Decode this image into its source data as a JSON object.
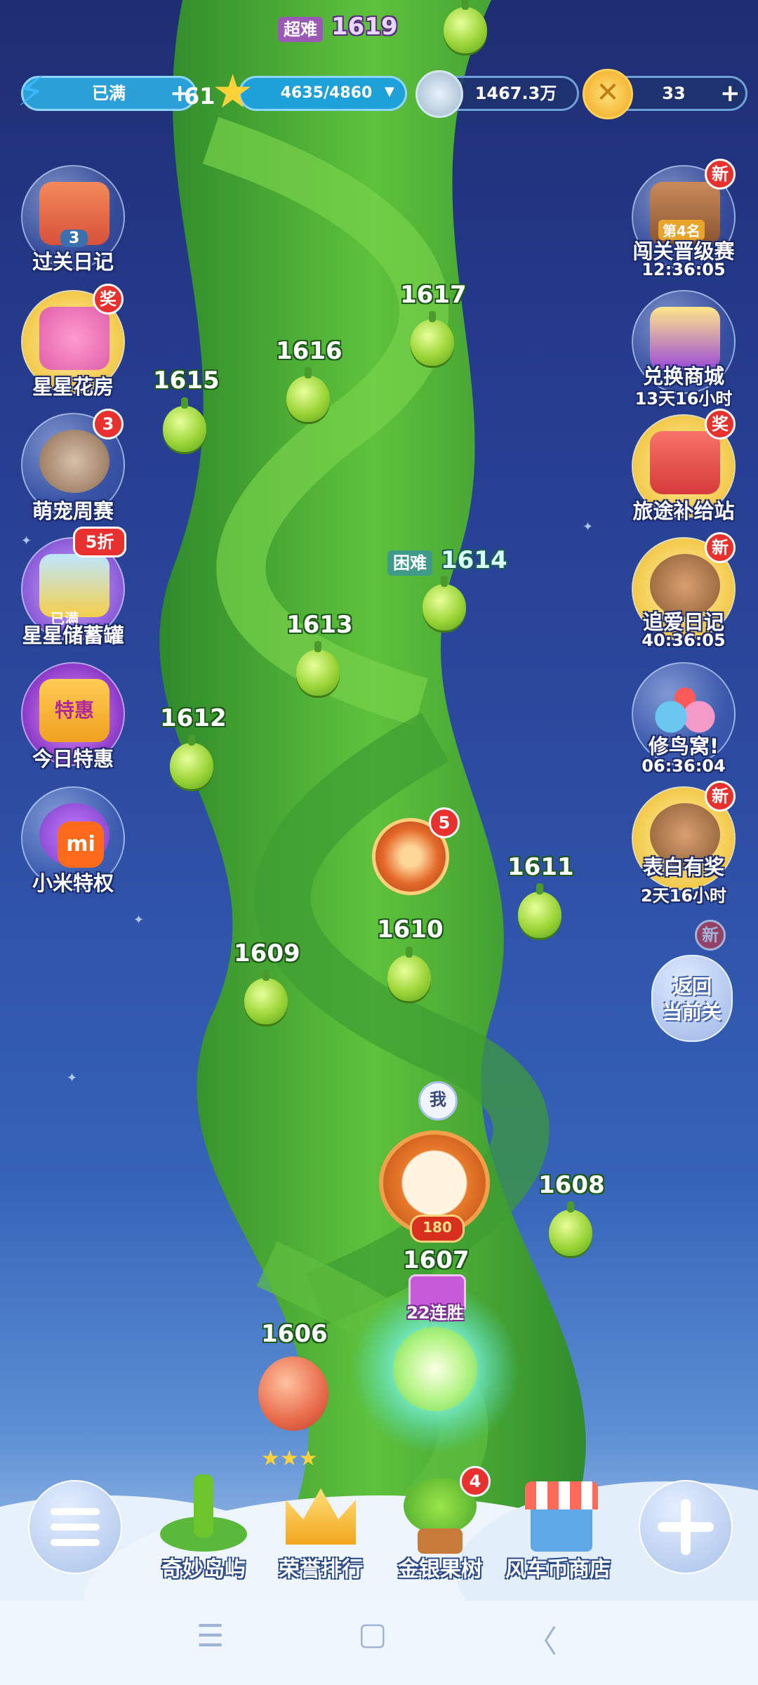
{
  "top_bar": {
    "energy_label": "已满",
    "star_progress": "4635/4860",
    "coins_silver": "1467.3万",
    "coins_gold": "33",
    "hidden_level_partial": "61"
  },
  "top_level": {
    "difficulty": "超难",
    "number": "1619"
  },
  "left_menu": [
    {
      "label": "过关日记",
      "count": "3"
    },
    {
      "label": "星星花房",
      "badge": "奖"
    },
    {
      "label": "萌宠周赛",
      "badge": "3"
    },
    {
      "label": "星星储蓄罐",
      "badge": "5折",
      "inner": "已满"
    },
    {
      "label": "今日特惠",
      "inner": "特惠"
    },
    {
      "label": "小米特权"
    }
  ],
  "right_menu": [
    {
      "label": "闯关晋级赛",
      "badge": "新",
      "inner": "第4名",
      "timer": "12:36:05"
    },
    {
      "label": "兑换商城",
      "timer": "13天16小时"
    },
    {
      "label": "旅途补给站",
      "badge": "奖"
    },
    {
      "label": "追爱日记",
      "badge": "新",
      "timer": "40:36:05"
    },
    {
      "label": "修鸟窝!",
      "timer": "06:36:04"
    },
    {
      "label": "表白有奖",
      "badge": "新",
      "timer": "2天16小时"
    }
  ],
  "return_button": {
    "label_line1": "返回",
    "label_line2": "当前关",
    "badge": "新"
  },
  "levels": [
    {
      "num": "1617"
    },
    {
      "num": "1616"
    },
    {
      "num": "1615"
    },
    {
      "num": "1614",
      "difficulty": "困难"
    },
    {
      "num": "1613"
    },
    {
      "num": "1612"
    },
    {
      "num": "1611"
    },
    {
      "num": "1610"
    },
    {
      "num": "1609"
    },
    {
      "num": "1608"
    },
    {
      "num": "1607"
    },
    {
      "num": "1606"
    }
  ],
  "wheel_badge": "5",
  "current_marker": {
    "me_label": "我",
    "teapot_count": "180",
    "streak": "22连胜"
  },
  "bottom_nav": [
    {
      "label": "奇妙岛屿"
    },
    {
      "label": "荣誉排行"
    },
    {
      "label": "金银果树",
      "badge": "4"
    },
    {
      "label": "风车币商店"
    }
  ],
  "colors": {
    "accent_green": "#6cc52a",
    "badge_red": "#e8302e",
    "hard_tag": "#3f9a8a",
    "super_hard_tag": "#9b59b6"
  }
}
